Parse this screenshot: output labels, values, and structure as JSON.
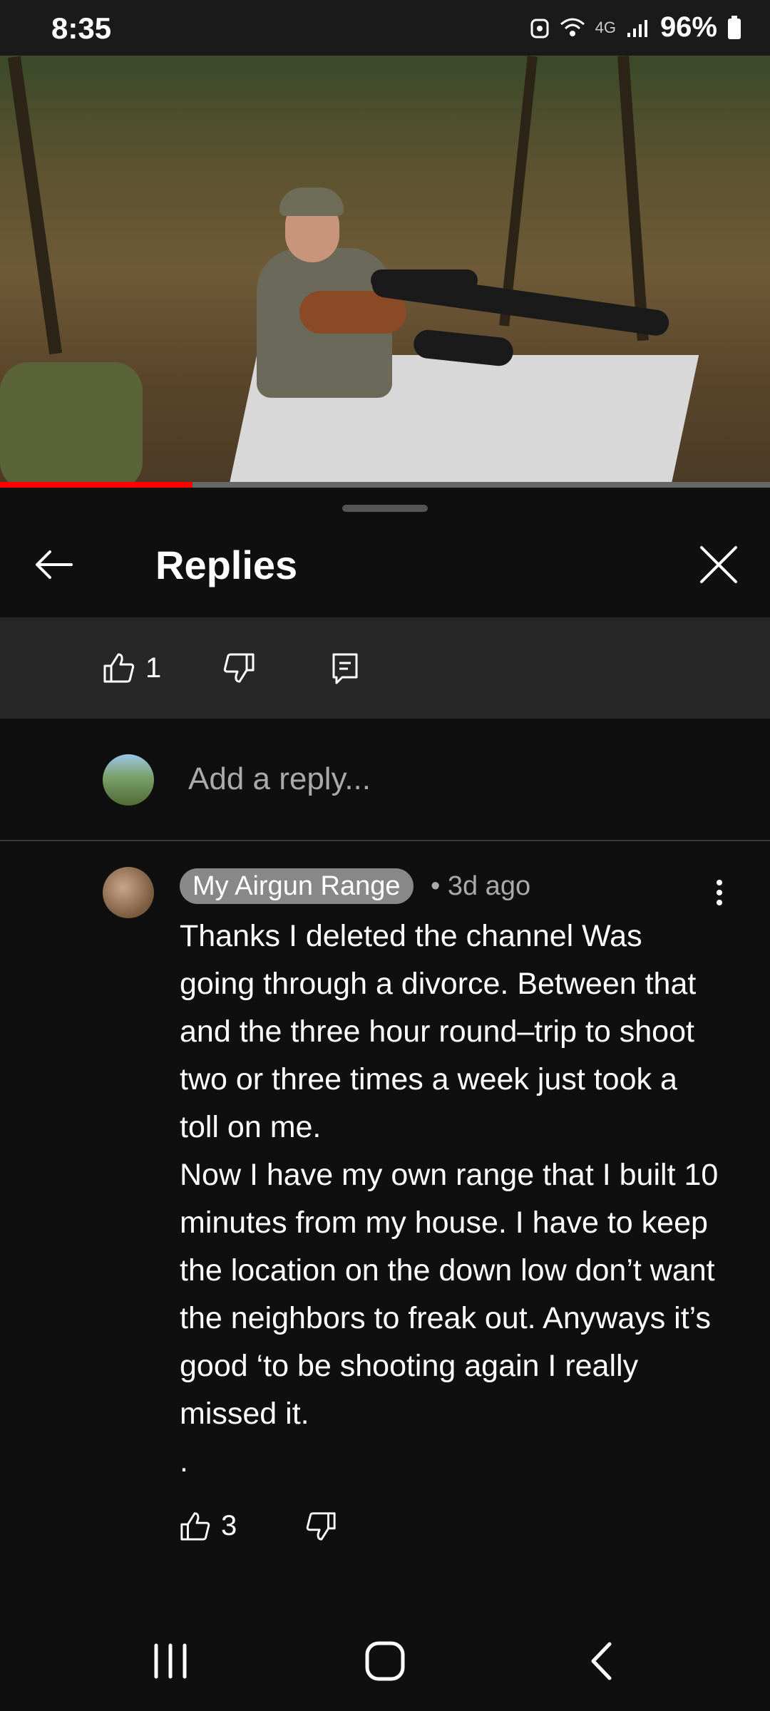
{
  "status": {
    "time": "8:35",
    "battery": "96%",
    "network": "4G"
  },
  "video": {
    "progress": 0.25
  },
  "header": {
    "title": "Replies"
  },
  "actions": {
    "likes": "1"
  },
  "reply_input": {
    "placeholder": "Add a reply..."
  },
  "comment": {
    "channel": "My Airgun Range",
    "time": "• 3d ago",
    "text": "Thanks I deleted the channel Was going through a divorce. Between that and the three hour round–trip to shoot two or three times a week just took a toll on me.\nNow I have my own range that I built 10 minutes from my house.  I have to keep the location on the down low don’t want the neighbors to freak out.  Anyways it’s good ‘to be shooting again I really missed it.\n.",
    "likes": "3"
  }
}
